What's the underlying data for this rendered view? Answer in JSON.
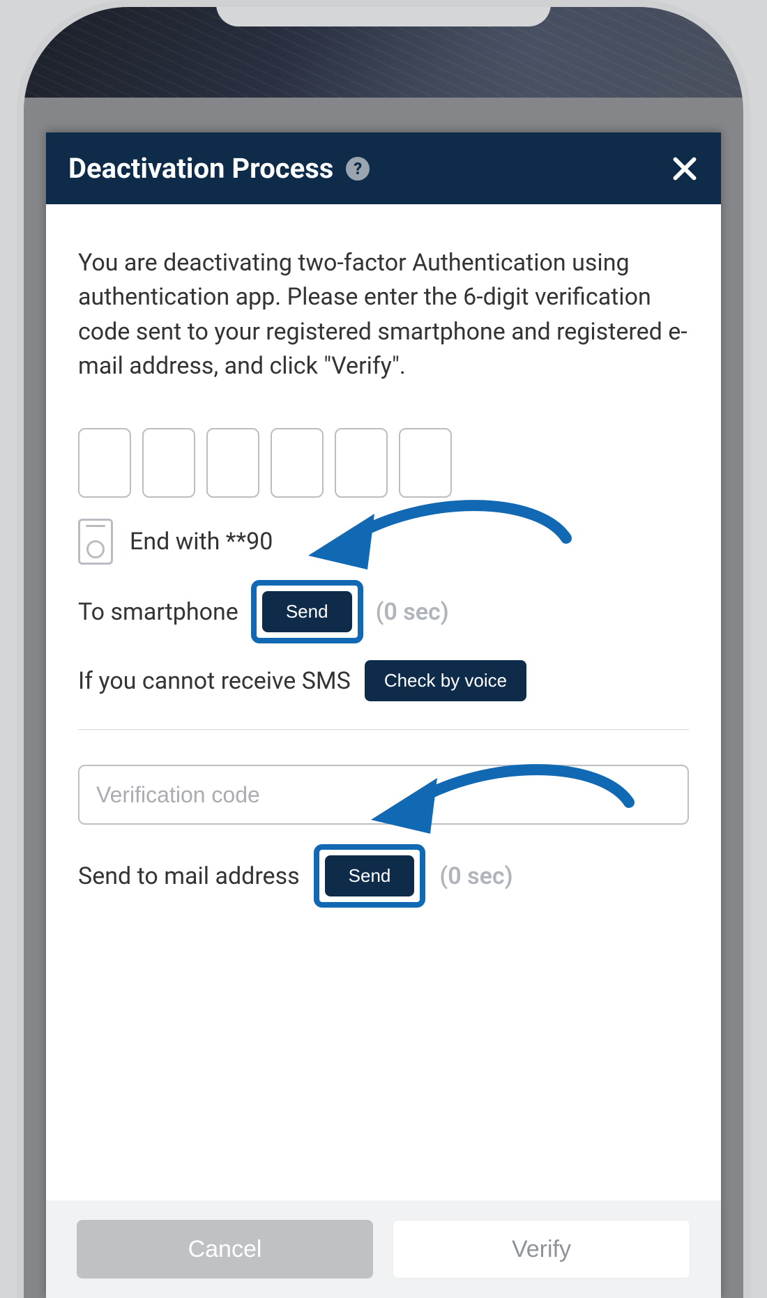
{
  "header": {
    "title": "Deactivation Process"
  },
  "body": {
    "instructions": "You are deactivating two-factor Authentication using authentication app. Please enter the 6-digit verification code sent to your registered smartphone and registered e-mail address, and click \"Verify\".",
    "phone_end_with": "End with **90",
    "to_smartphone_label": "To smartphone",
    "send_button": "Send",
    "sms_timer": "(0 sec)",
    "sms_fallback_label": "If you cannot receive SMS",
    "voice_button": "Check by voice",
    "verification_placeholder": "Verification code",
    "mail_label": "Send to mail address",
    "mail_send_button": "Send",
    "mail_timer": "(0 sec)"
  },
  "footer": {
    "cancel": "Cancel",
    "verify": "Verify"
  }
}
